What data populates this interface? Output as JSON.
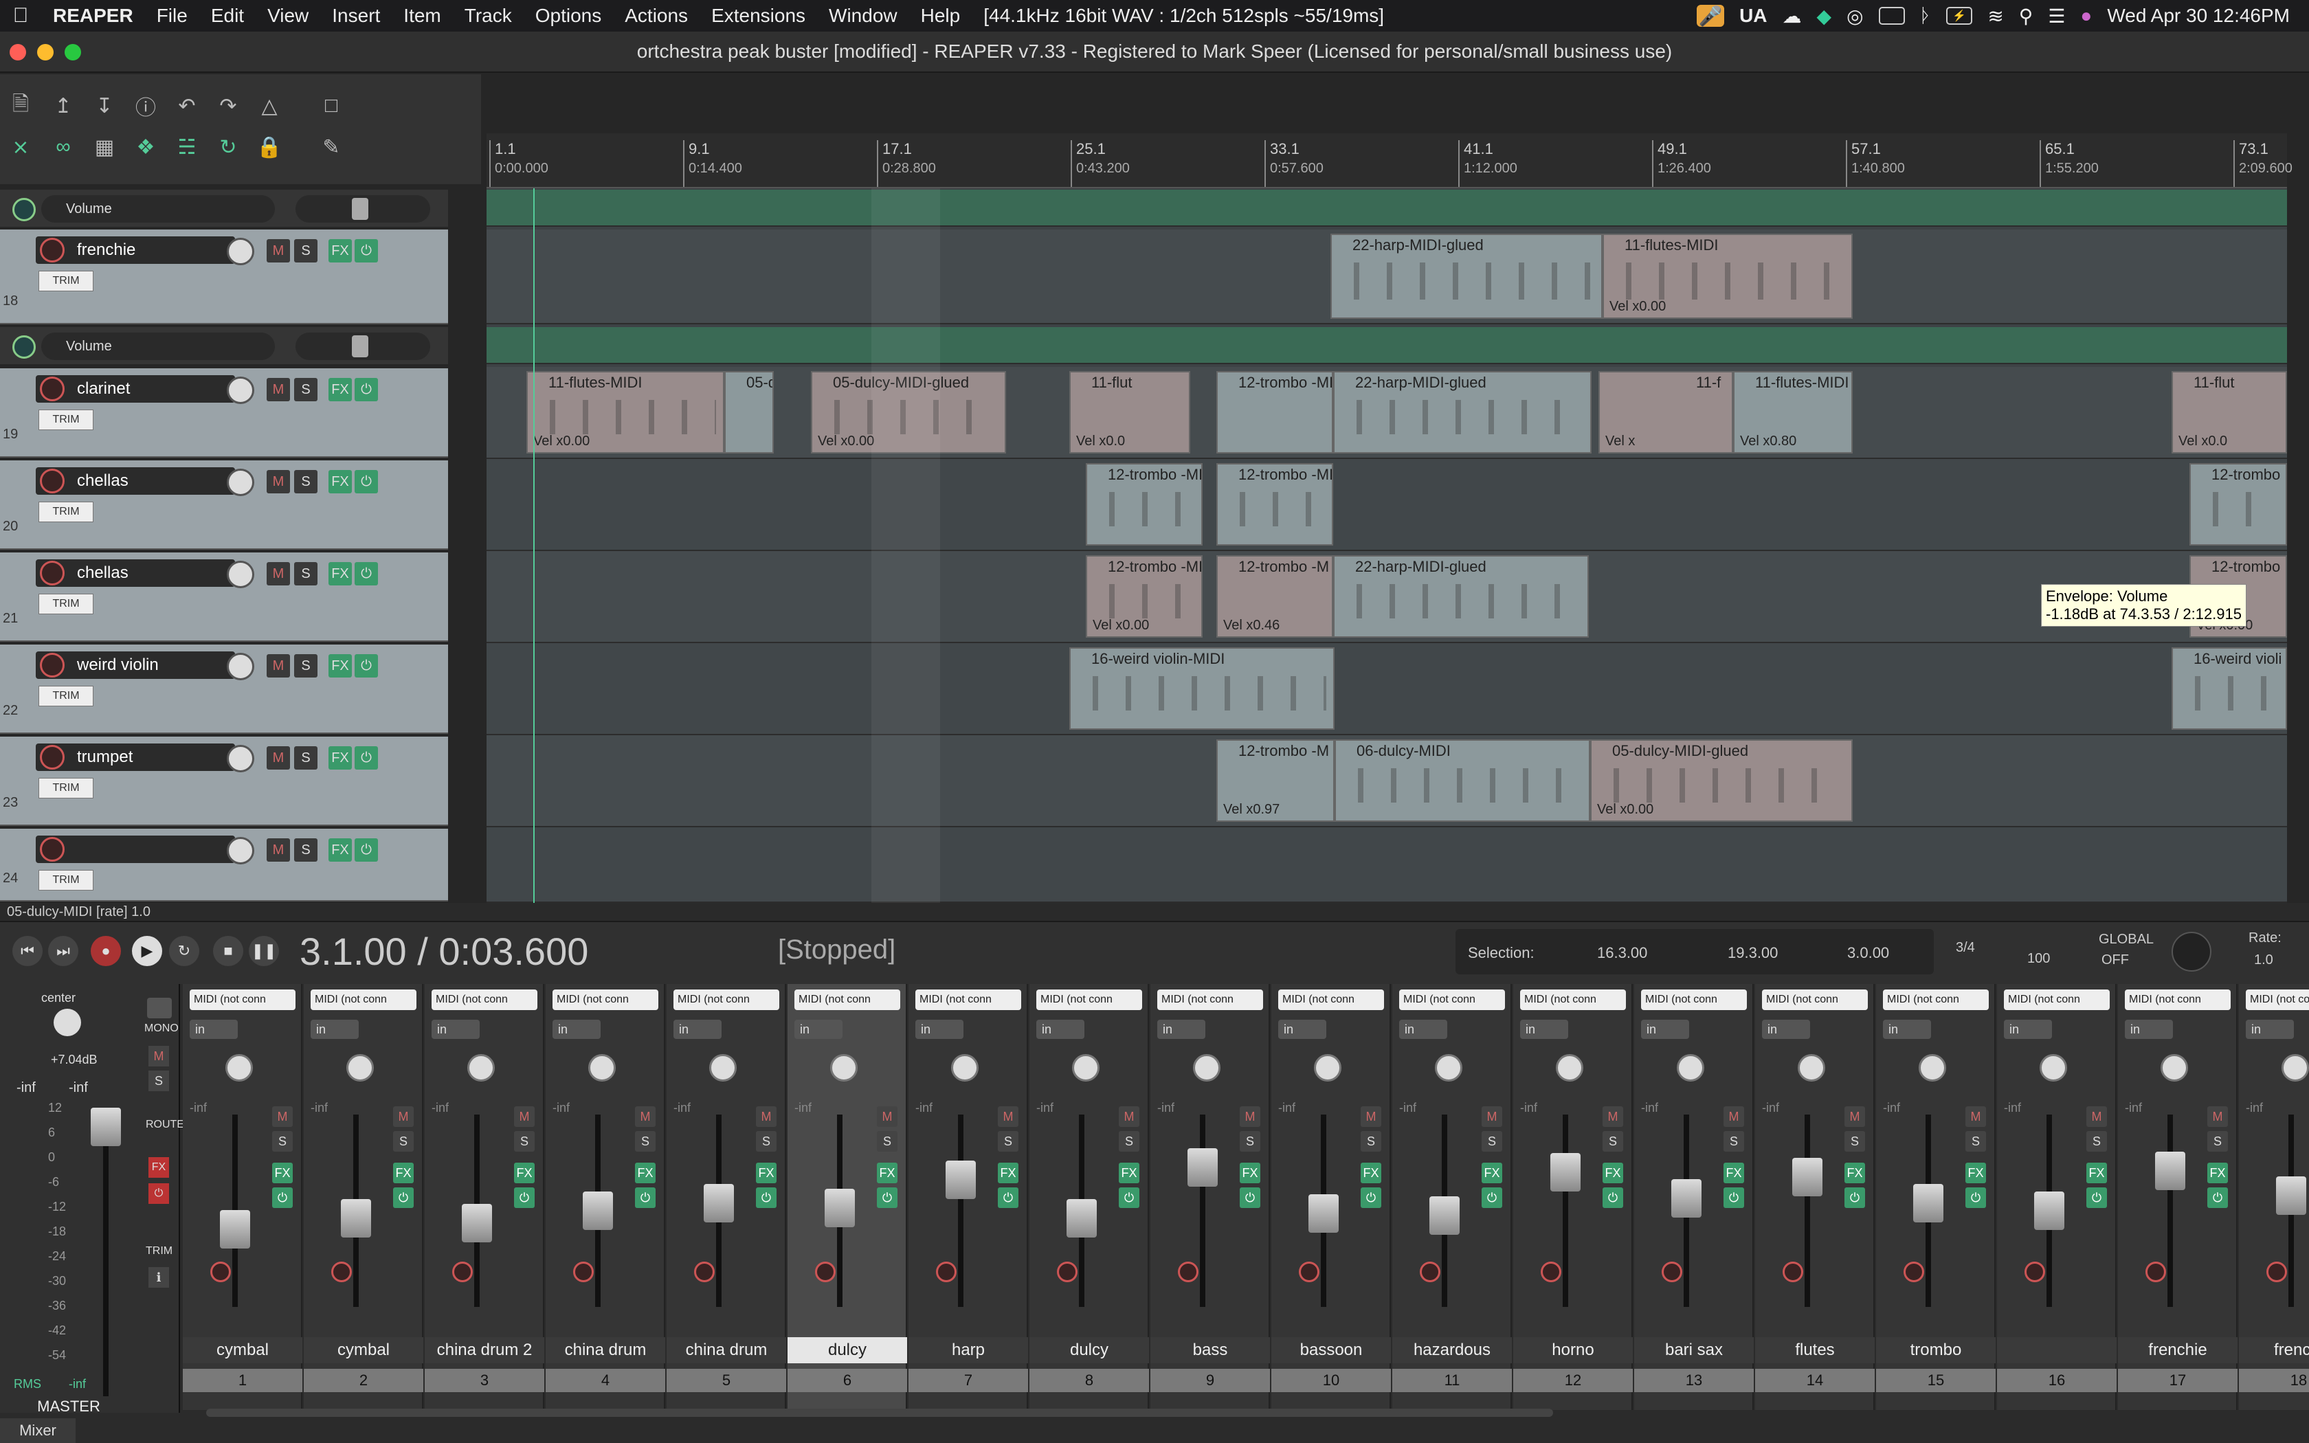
{
  "menubar": {
    "app": "REAPER",
    "items": [
      "File",
      "Edit",
      "View",
      "Insert",
      "Item",
      "Track",
      "Options",
      "Actions",
      "Extensions",
      "Window",
      "Help"
    ],
    "audio_info": "[44.1kHz 16bit WAV : 1/2ch 512spls ~55/19ms]",
    "ua": "UA",
    "datetime": "Wed Apr 30  12:46PM"
  },
  "window": {
    "title": "ortchestra peak buster [modified] - REAPER v7.33 - Registered to Mark Speer (Licensed for personal/small business use)"
  },
  "ruler": {
    "ticks": [
      {
        "bar": "1.1",
        "time": "0:00.000"
      },
      {
        "bar": "9.1",
        "time": "0:14.400"
      },
      {
        "bar": "17.1",
        "time": "0:28.800"
      },
      {
        "bar": "25.1",
        "time": "0:43.200"
      },
      {
        "bar": "33.1",
        "time": "0:57.600"
      },
      {
        "bar": "41.1",
        "time": "1:12.000"
      },
      {
        "bar": "49.1",
        "time": "1:26.400"
      },
      {
        "bar": "57.1",
        "time": "1:40.800"
      },
      {
        "bar": "65.1",
        "time": "1:55.200"
      },
      {
        "bar": "73.1",
        "time": "2:09.600"
      }
    ]
  },
  "envelope_label": "Volume",
  "tracks": [
    {
      "num": "18",
      "name": "frenchie"
    },
    {
      "num": "19",
      "name": "clarinet"
    },
    {
      "num": "20",
      "name": "chellas"
    },
    {
      "num": "21",
      "name": "chellas"
    },
    {
      "num": "22",
      "name": "weird violin"
    },
    {
      "num": "23",
      "name": "trumpet"
    },
    {
      "num": "24",
      "name": ""
    }
  ],
  "track_buttons": {
    "mute": "M",
    "solo": "S",
    "fx": "FX",
    "trim": "TRIM"
  },
  "items": {
    "t18": [
      {
        "name": "22-harp-MIDI-glued",
        "vel": ""
      },
      {
        "name": "11-flutes-MIDI",
        "vel": "Vel x0.00"
      }
    ],
    "t19": [
      {
        "name": "11-flutes-MIDI",
        "vel": "Vel x0.00"
      },
      {
        "name": "05-d",
        "vel": ""
      },
      {
        "name": "05-dulcy-MIDI-glued",
        "vel": "Vel x0.00"
      },
      {
        "name": "11-flut",
        "vel": "Vel x0.0"
      },
      {
        "name": "12-trombo -MI",
        "vel": ""
      },
      {
        "name": "22-harp-MIDI-glued",
        "vel": ""
      },
      {
        "name": "11-f",
        "vel": "Vel x"
      },
      {
        "name": "11-flutes-MIDI",
        "vel": "Vel x0.80"
      },
      {
        "name": "11-flut",
        "vel": "Vel x0.0"
      }
    ],
    "t20": [
      {
        "name": "12-trombo -MI",
        "vel": ""
      },
      {
        "name": "12-trombo -MI",
        "vel": ""
      },
      {
        "name": "12-trombo",
        "vel": ""
      }
    ],
    "t21": [
      {
        "name": "12-trombo -MI",
        "vel": "Vel x0.00"
      },
      {
        "name": "12-trombo -M",
        "vel": "Vel x0.46"
      },
      {
        "name": "22-harp-MIDI-glued",
        "vel": ""
      },
      {
        "name": "12-trombo",
        "vel": "Vel x0.00"
      }
    ],
    "t22": [
      {
        "name": "16-weird violin-MIDI",
        "vel": ""
      },
      {
        "name": "16-weird violi",
        "vel": ""
      }
    ],
    "t23": [
      {
        "name": "12-trombo -M",
        "vel": "Vel x0.97"
      },
      {
        "name": "06-dulcy-MIDI",
        "vel": ""
      },
      {
        "name": "05-dulcy-MIDI-glued",
        "vel": "Vel x0.00"
      }
    ]
  },
  "tooltip": {
    "line1": "Envelope: Volume",
    "line2": "-1.18dB at 74.3.53 / 2:12.915"
  },
  "status": "05-dulcy-MIDI [rate] 1.0",
  "transport": {
    "position": "3.1.00 / 0:03.600",
    "state": "[Stopped]",
    "selection_label": "Selection:",
    "sel_start": "16.3.00",
    "sel_end": "19.3.00",
    "sel_len": "3.0.00",
    "time_sig": "3/4",
    "bpm": "100",
    "global_label": "GLOBAL",
    "global_value": "OFF",
    "rate_label": "Rate:",
    "rate_value": "1.0"
  },
  "master": {
    "pan": "center",
    "peak": "+7.04dB",
    "inf_left": "-inf",
    "inf_right": "-inf",
    "rms": "RMS",
    "rms_val": "-inf",
    "label": "MASTER",
    "mono": "MONO",
    "route": "ROUTE",
    "trim": "TRIM",
    "scale": [
      "12",
      "6",
      "0",
      "-6",
      "-12",
      "-18",
      "-24",
      "-30",
      "-36",
      "-42",
      "-54"
    ]
  },
  "mixer_strip": {
    "io": "MIDI (not conn",
    "input": "in",
    "inf": "-inf"
  },
  "strips": [
    {
      "name": "cymbal",
      "idx": "1",
      "fader": 0.38
    },
    {
      "name": "cymbal",
      "idx": "2",
      "fader": 0.45
    },
    {
      "name": "china drum 2",
      "idx": "3",
      "fader": 0.42
    },
    {
      "name": "china drum",
      "idx": "4",
      "fader": 0.5
    },
    {
      "name": "china drum",
      "idx": "5",
      "fader": 0.55
    },
    {
      "name": "dulcy",
      "idx": "6",
      "fader": 0.52
    },
    {
      "name": "harp",
      "idx": "7",
      "fader": 0.7
    },
    {
      "name": "dulcy",
      "idx": "8",
      "fader": 0.45
    },
    {
      "name": "bass",
      "idx": "9",
      "fader": 0.78
    },
    {
      "name": "bassoon",
      "idx": "10",
      "fader": 0.48
    },
    {
      "name": "hazardous",
      "idx": "11",
      "fader": 0.47
    },
    {
      "name": "horno",
      "idx": "12",
      "fader": 0.75
    },
    {
      "name": "bari sax",
      "idx": "13",
      "fader": 0.58
    },
    {
      "name": "flutes",
      "idx": "14",
      "fader": 0.72
    },
    {
      "name": "trombo",
      "idx": "15",
      "fader": 0.55
    },
    {
      "name": "",
      "idx": "16",
      "fader": 0.5
    },
    {
      "name": "frenchie",
      "idx": "17",
      "fader": 0.76
    },
    {
      "name": "frenchi",
      "idx": "18",
      "fader": 0.6
    }
  ],
  "mixer_tab": "Mixer"
}
